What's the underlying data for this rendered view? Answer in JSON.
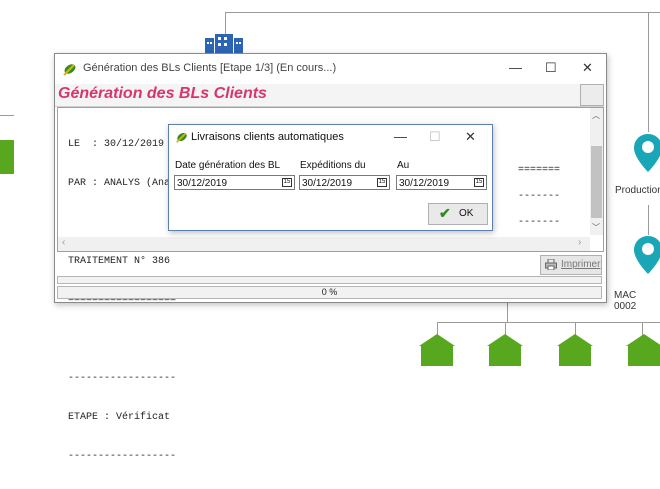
{
  "background": {
    "right_labels": [
      "Production",
      "MAC 0002"
    ],
    "colors": {
      "teal": "#19a7b8",
      "green": "#58a81f",
      "blue": "#2e64b5"
    }
  },
  "main_window": {
    "title": "Génération des BLs Clients [Etape 1/3] (En cours...)",
    "heading": "Génération des BLs Clients",
    "controls": {
      "minimize": "—",
      "maximize": "☐",
      "close": "✕"
    },
    "log_lines": [
      "LE  : 30/12/2019   A : 12:03:31",
      "PAR : ANALYS (Ana",
      "",
      "TRAITEMENT N° 386",
      "==================",
      "",
      "------------------",
      "ETAPE : Vérificat",
      "------------------"
    ],
    "print_label": "Imprimer",
    "progress_text": "0 %",
    "heading_color": "#d8366b"
  },
  "dialog": {
    "title": "Livraisons clients automatiques",
    "controls": {
      "minimize": "—",
      "maximize": "☐",
      "close": "✕"
    },
    "fields": [
      {
        "label": "Date génération des BL",
        "value": "30/12/2019"
      },
      {
        "label": "Expéditions du",
        "value": "30/12/2019"
      },
      {
        "label": "Au",
        "value": "30/12/2019"
      }
    ],
    "ok_label": "OK"
  }
}
